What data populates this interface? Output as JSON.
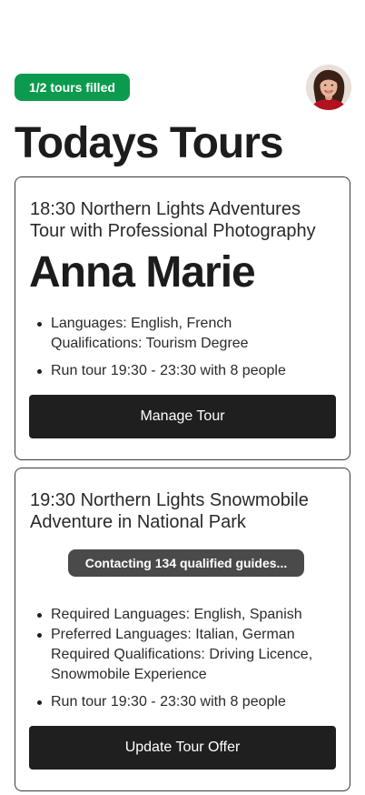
{
  "header": {
    "badge": "1/2 tours filled",
    "title": "Todays Tours",
    "avatar_icon": "user-avatar-photo"
  },
  "tours": [
    {
      "heading": "18:30 Northern Lights Adventures Tour with Professional Photography",
      "guide_name": "Anna Marie",
      "details": [
        [
          "Languages: English, French",
          "Qualifications: Tourism Degree"
        ],
        [
          "Run tour 19:30 - 23:30 with 8 people"
        ]
      ],
      "action_label": "Manage Tour"
    },
    {
      "heading": "19:30 Northern Lights Snowmobile Adventure in National Park",
      "status": "Contacting 134 qualified guides...",
      "details": [
        [
          "Required Languages: English, Spanish"
        ],
        [
          "Preferred Languages: Italian, German",
          "Required Qualifications: Driving Licence,",
          "Snowmobile Experience"
        ],
        [
          "Run tour 19:30 - 23:30 with 8 people"
        ]
      ],
      "action_label": "Update Tour Offer"
    }
  ],
  "colors": {
    "badge_bg": "#0c9b4e",
    "button_bg": "#1f1f1f",
    "status_bg": "#4a4a4a",
    "card_border": "#3a3a3a"
  }
}
